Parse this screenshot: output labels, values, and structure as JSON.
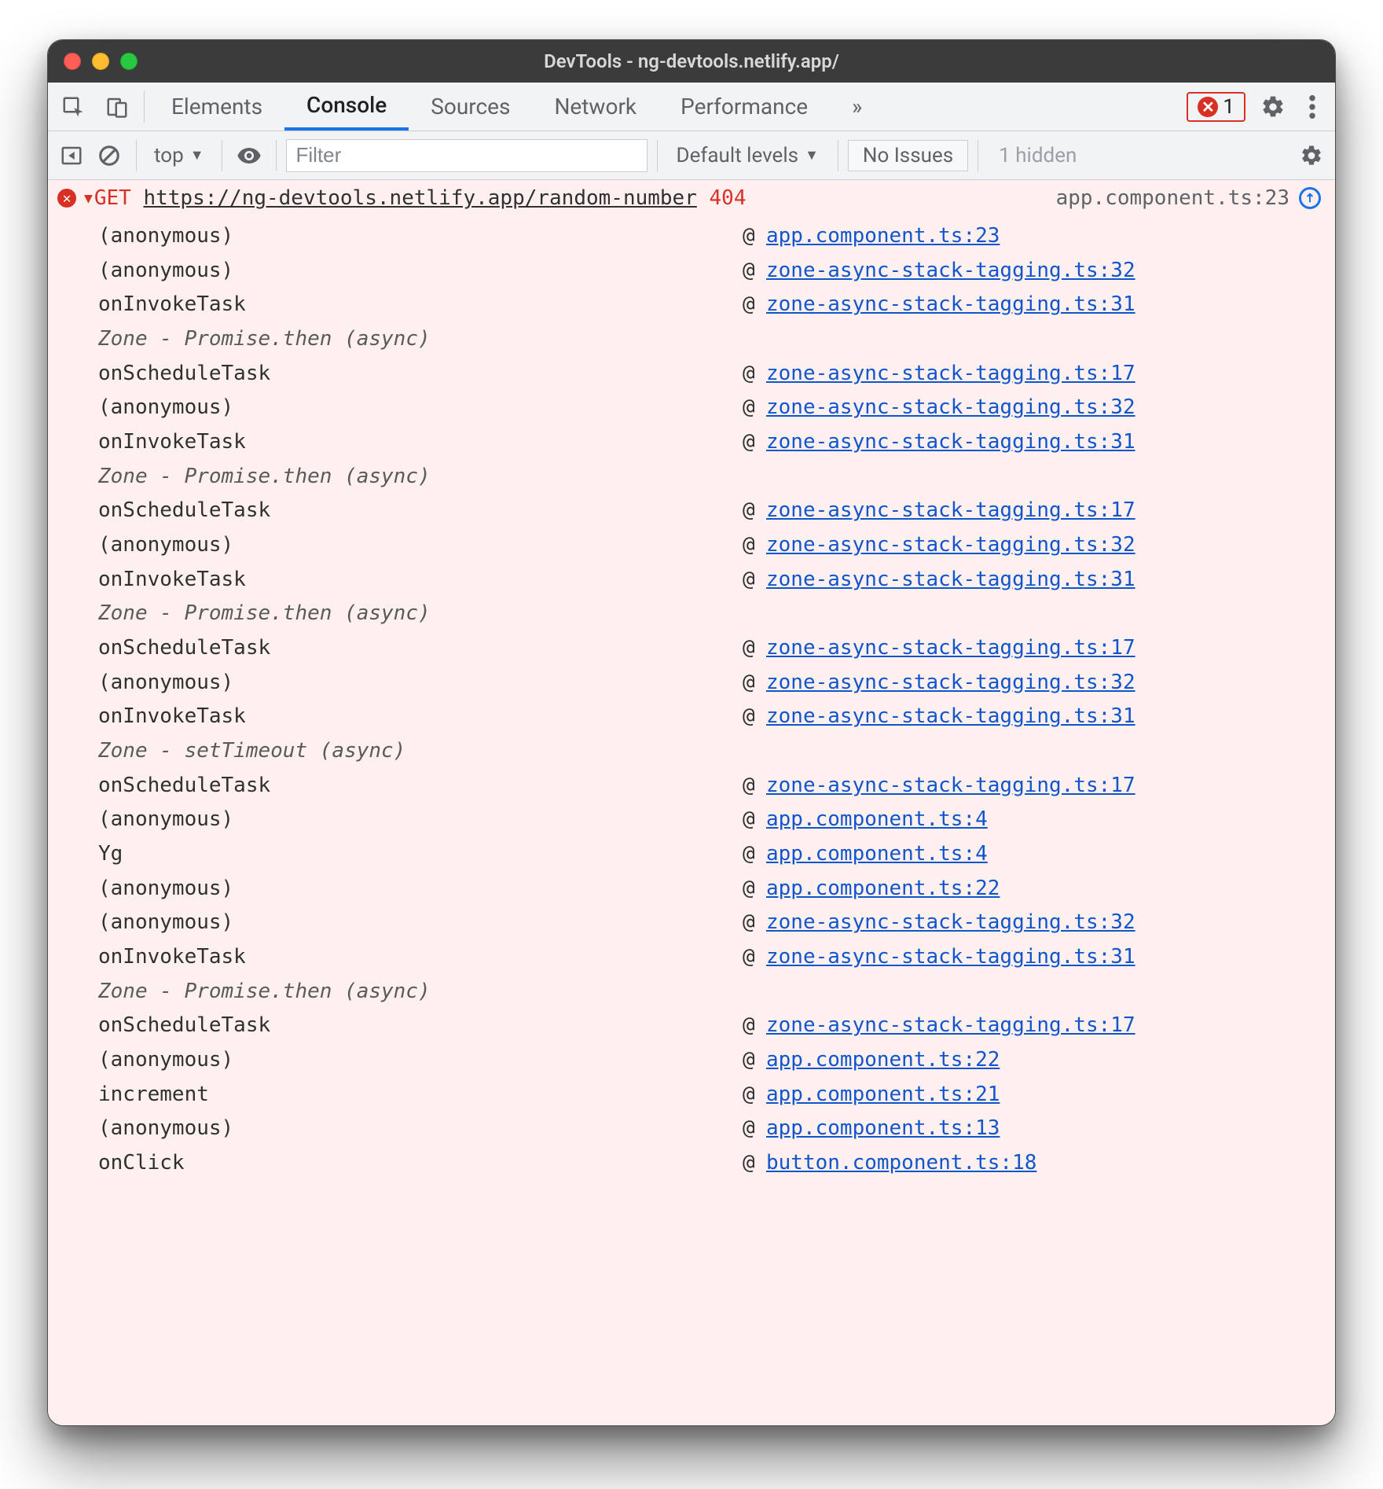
{
  "window": {
    "title": "DevTools - ng-devtools.netlify.app/"
  },
  "tabs": {
    "elements": "Elements",
    "console": "Console",
    "sources": "Sources",
    "network": "Network",
    "performance": "Performance",
    "more_glyph": "»",
    "error_count": "1"
  },
  "toolbar": {
    "context": "top",
    "filter_placeholder": "Filter",
    "levels": "Default levels",
    "no_issues": "No Issues",
    "hidden": "1 hidden"
  },
  "console": {
    "method": "GET",
    "url": "https://ng-devtools.netlify.app/random-number",
    "status": "404",
    "origin": "app.component.ts:23",
    "async_promise": "Zone - Promise.then (async)",
    "async_timeout": "Zone - setTimeout (async)",
    "frames": [
      {
        "fn": "(anonymous)",
        "loc": "app.component.ts:23"
      },
      {
        "fn": "(anonymous)",
        "loc": "zone-async-stack-tagging.ts:32"
      },
      {
        "fn": "onInvokeTask",
        "loc": "zone-async-stack-tagging.ts:31"
      },
      {
        "async": "promise"
      },
      {
        "fn": "onScheduleTask",
        "loc": "zone-async-stack-tagging.ts:17"
      },
      {
        "fn": "(anonymous)",
        "loc": "zone-async-stack-tagging.ts:32"
      },
      {
        "fn": "onInvokeTask",
        "loc": "zone-async-stack-tagging.ts:31"
      },
      {
        "async": "promise"
      },
      {
        "fn": "onScheduleTask",
        "loc": "zone-async-stack-tagging.ts:17"
      },
      {
        "fn": "(anonymous)",
        "loc": "zone-async-stack-tagging.ts:32"
      },
      {
        "fn": "onInvokeTask",
        "loc": "zone-async-stack-tagging.ts:31"
      },
      {
        "async": "promise"
      },
      {
        "fn": "onScheduleTask",
        "loc": "zone-async-stack-tagging.ts:17"
      },
      {
        "fn": "(anonymous)",
        "loc": "zone-async-stack-tagging.ts:32"
      },
      {
        "fn": "onInvokeTask",
        "loc": "zone-async-stack-tagging.ts:31"
      },
      {
        "async": "timeout"
      },
      {
        "fn": "onScheduleTask",
        "loc": "zone-async-stack-tagging.ts:17"
      },
      {
        "fn": "(anonymous)",
        "loc": "app.component.ts:4"
      },
      {
        "fn": "Yg",
        "loc": "app.component.ts:4"
      },
      {
        "fn": "(anonymous)",
        "loc": "app.component.ts:22"
      },
      {
        "fn": "(anonymous)",
        "loc": "zone-async-stack-tagging.ts:32"
      },
      {
        "fn": "onInvokeTask",
        "loc": "zone-async-stack-tagging.ts:31"
      },
      {
        "async": "promise"
      },
      {
        "fn": "onScheduleTask",
        "loc": "zone-async-stack-tagging.ts:17"
      },
      {
        "fn": "(anonymous)",
        "loc": "app.component.ts:22"
      },
      {
        "fn": "increment",
        "loc": "app.component.ts:21"
      },
      {
        "fn": "(anonymous)",
        "loc": "app.component.ts:13"
      },
      {
        "fn": "onClick",
        "loc": "button.component.ts:18"
      }
    ]
  }
}
